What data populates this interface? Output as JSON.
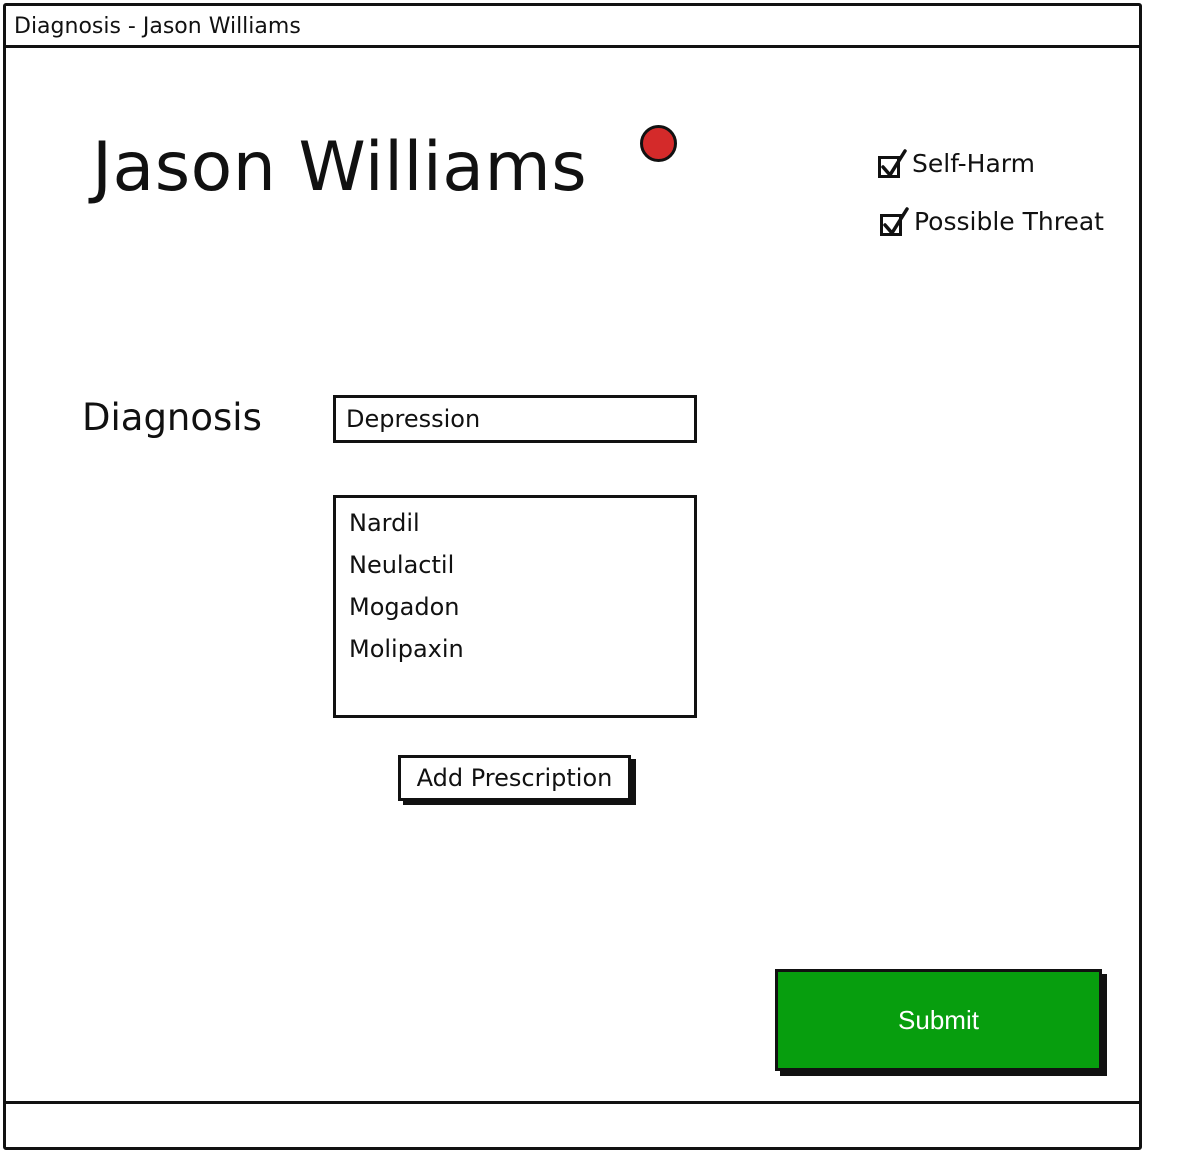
{
  "window": {
    "title": "Diagnosis - Jason Williams"
  },
  "patient": {
    "name": "Jason Williams",
    "alert_color": "#d42a2a"
  },
  "flags": [
    {
      "label": "Self-Harm",
      "checked": true
    },
    {
      "label": "Possible Threat",
      "checked": true
    }
  ],
  "diagnosis": {
    "label": "Diagnosis",
    "value": "Depression"
  },
  "prescriptions": {
    "items": [
      "Nardil",
      "Neulactil",
      "Mogadon",
      "Molipaxin"
    ],
    "add_label": "Add Prescription"
  },
  "submit": {
    "label": "Submit",
    "color": "#079e0e"
  }
}
